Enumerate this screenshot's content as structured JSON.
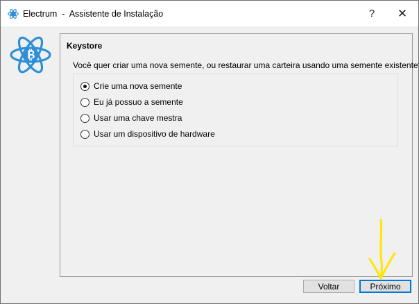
{
  "window": {
    "app_name": "Electrum",
    "separator": "-",
    "title": "Assistente de Instalação",
    "help_label": "?",
    "close_label": "✕"
  },
  "keystore": {
    "heading": "Keystore",
    "question": "Você quer criar uma nova semente, ou restaurar uma carteira usando uma semente existente?",
    "options": [
      {
        "label": "Crie uma nova semente",
        "checked": true
      },
      {
        "label": "Eu já possuo a semente",
        "checked": false
      },
      {
        "label": "Usar uma chave mestra",
        "checked": false
      },
      {
        "label": "Usar um dispositivo de hardware",
        "checked": false
      }
    ]
  },
  "buttons": {
    "back_label": "Voltar",
    "next_label": "Próximo"
  },
  "colors": {
    "accent": "#0078d7",
    "electrum_blue": "#2f8fd6",
    "annotation_arrow": "#ffe600"
  },
  "icons": {
    "app": "electrum-logo-icon",
    "logo": "electrum-bitcoin-atom-icon",
    "annotation": "yellow-arrow-down-icon"
  }
}
